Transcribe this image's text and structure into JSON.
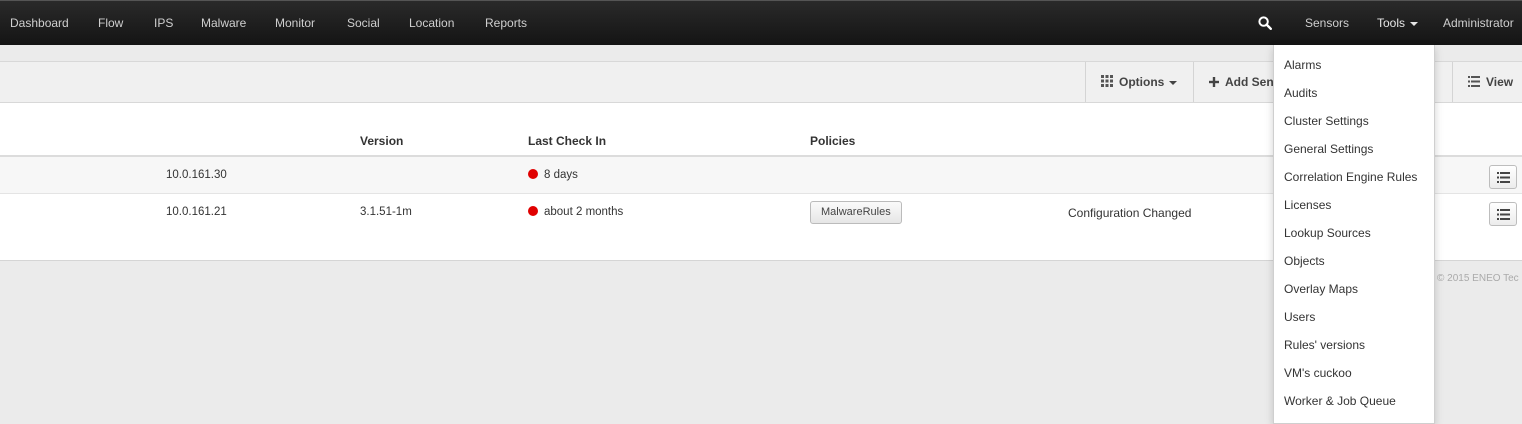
{
  "navbar": {
    "left_items": [
      "Dashboard",
      "Flow",
      "IPS",
      "Malware",
      "Monitor",
      "Social",
      "Location",
      "Reports"
    ],
    "search_icon": "search-icon",
    "sensors_label": "Sensors",
    "tools_label": "Tools",
    "user_label": "Administrator"
  },
  "toolbar": {
    "options_label": "Options",
    "add_sensor_label": "Add Sen",
    "view_label": "View"
  },
  "table": {
    "headers": {
      "version": "Version",
      "last_check_in": "Last Check In",
      "policies": "Policies"
    },
    "rows": [
      {
        "ip": "10.0.161.30",
        "version": "",
        "last_check_in": "8 days",
        "policy": "",
        "status": ""
      },
      {
        "ip": "10.0.161.21",
        "version": "3.1.51-1m",
        "last_check_in": "about 2 months",
        "policy": "MalwareRules",
        "status": "Configuration Changed"
      }
    ],
    "status_dot_color": "#e00000"
  },
  "footer": {
    "copyright": "© 2015 ENEO Tec"
  },
  "tools_menu": {
    "items": [
      "Alarms",
      "Audits",
      "Cluster Settings",
      "General Settings",
      "Correlation Engine Rules",
      "Licenses",
      "Lookup Sources",
      "Objects",
      "Overlay Maps",
      "Users",
      "Rules' versions",
      "VM's cuckoo",
      "Worker & Job Queue"
    ]
  }
}
